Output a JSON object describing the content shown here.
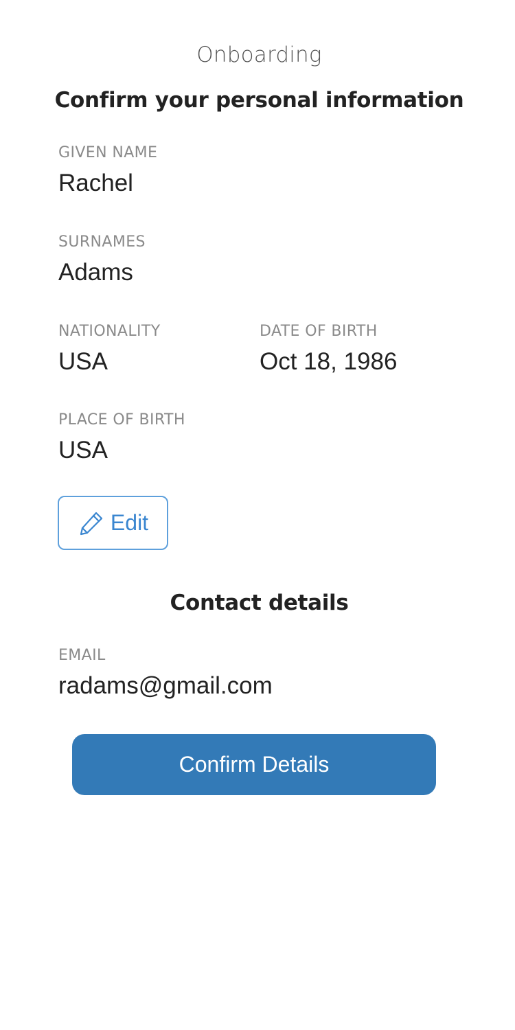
{
  "header": {
    "title": "Onboarding"
  },
  "personal": {
    "heading": "Confirm your personal information",
    "given_name": {
      "label": "GIVEN NAME",
      "value": "Rachel"
    },
    "surnames": {
      "label": "SURNAMES",
      "value": "Adams"
    },
    "nationality": {
      "label": "NATIONALITY",
      "value": "USA"
    },
    "date_of_birth": {
      "label": "DATE OF BIRTH",
      "value": "Oct 18, 1986"
    },
    "place_of_birth": {
      "label": "PLACE OF BIRTH",
      "value": "USA"
    },
    "edit_button": {
      "label": "Edit",
      "icon": "pencil-icon"
    }
  },
  "contact": {
    "heading": "Contact details",
    "email": {
      "label": "EMAIL",
      "value": "radams@gmail.com"
    }
  },
  "actions": {
    "confirm_label": "Confirm Details"
  },
  "colors": {
    "accent": "#337ab7",
    "edit_border": "#5ea0dc",
    "edit_text": "#3a86d0",
    "label_gray": "#8a8a8a",
    "text": "#222222"
  }
}
